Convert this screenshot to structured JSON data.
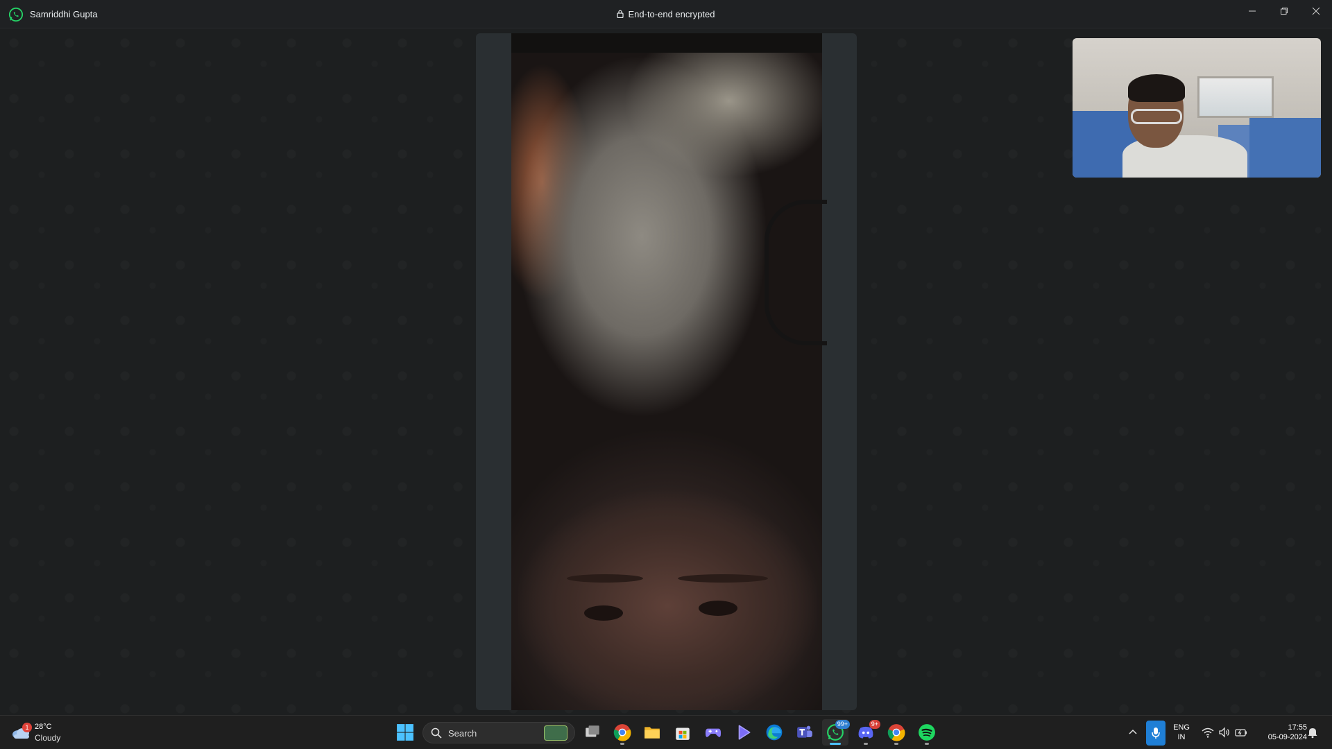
{
  "window": {
    "contact_name": "Samriddhi Gupta",
    "encryption_text": "End-to-end encrypted",
    "controls": [
      "minimize",
      "maximize",
      "close"
    ]
  },
  "call": {
    "remote_video": "remote participant video feed",
    "self_view": "local camera preview"
  },
  "taskbar": {
    "weather": {
      "temp": "28°C",
      "condition": "Cloudy",
      "badge": "1"
    },
    "search_placeholder": "Search",
    "apps": [
      {
        "name": "start",
        "icon": "windows-icon"
      },
      {
        "name": "task-view",
        "icon": "task-view-icon"
      },
      {
        "name": "chrome",
        "icon": "chrome-icon",
        "badge": ""
      },
      {
        "name": "file-explorer",
        "icon": "folder-icon"
      },
      {
        "name": "microsoft-store",
        "icon": "store-icon"
      },
      {
        "name": "game-controller",
        "icon": "gamepad-icon"
      },
      {
        "name": "media-player",
        "icon": "play-icon"
      },
      {
        "name": "edge",
        "icon": "edge-icon"
      },
      {
        "name": "teams",
        "icon": "teams-icon"
      },
      {
        "name": "whatsapp",
        "icon": "whatsapp-icon",
        "badge": "99+"
      },
      {
        "name": "discord",
        "icon": "discord-icon",
        "badge": "9+"
      },
      {
        "name": "chrome-profile",
        "icon": "chrome-icon"
      },
      {
        "name": "spotify",
        "icon": "spotify-icon"
      }
    ],
    "tray": {
      "lang_top": "ENG",
      "lang_bottom": "IN",
      "time": "17:55",
      "date": "05-09-2024"
    }
  },
  "colors": {
    "whatsapp_green": "#25d366",
    "taskbar_bg": "#1f1f1f",
    "accent_blue": "#1f7fd6"
  }
}
